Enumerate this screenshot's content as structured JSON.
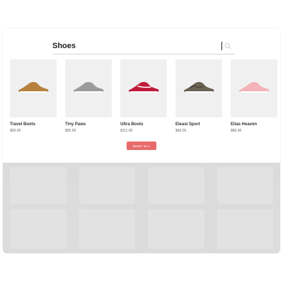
{
  "search": {
    "value": "Shoes",
    "placeholder": ""
  },
  "products": [
    {
      "name": "Travel Boots",
      "price": "$99.00",
      "icon": "shoe-icon",
      "color": "#b7813d"
    },
    {
      "name": "Tiny Paws",
      "price": "$95.00",
      "icon": "shoe-icon",
      "color": "#9b9b9b"
    },
    {
      "name": "Ultra Boots",
      "price": "$111.00",
      "icon": "shoe-icon",
      "color": "#c01b39"
    },
    {
      "name": "Eleasi Sport",
      "price": "$90.00",
      "icon": "shoe-icon",
      "color": "#6a6354"
    },
    {
      "name": "Elias Heaven",
      "price": "$85.00",
      "icon": "shoe-icon",
      "color": "#f2b3b9"
    }
  ],
  "cta": {
    "label": "SHOP ALL",
    "color": "#e86a6a"
  }
}
